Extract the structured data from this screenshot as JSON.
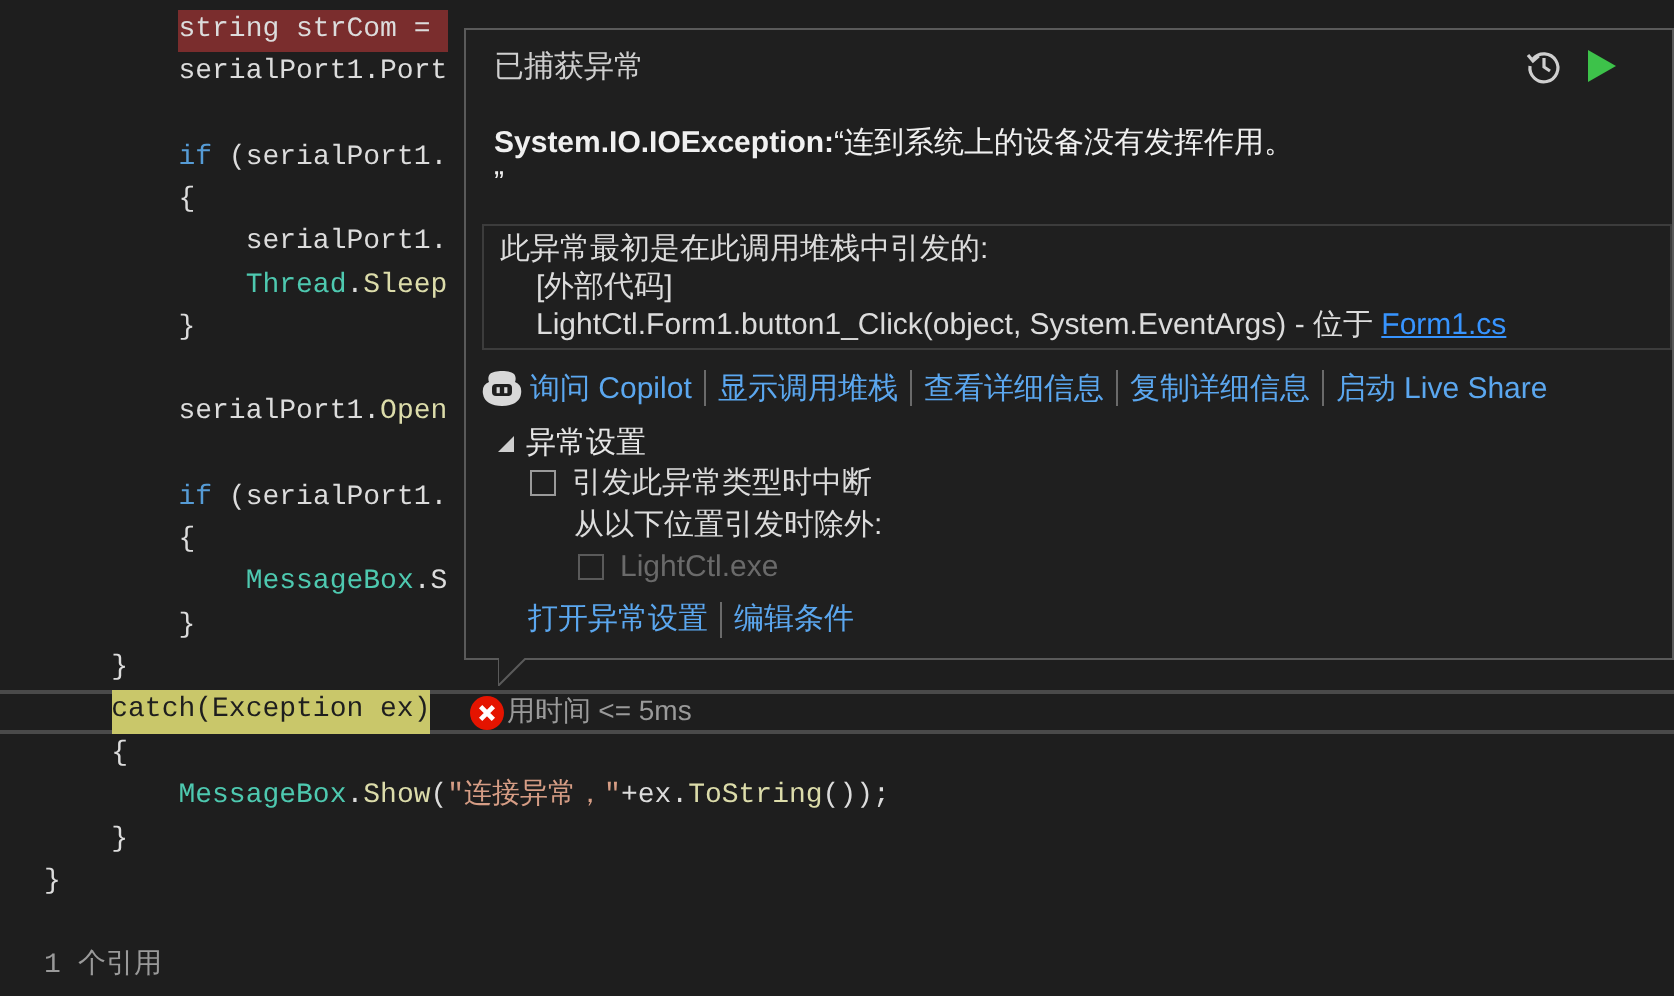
{
  "editor": {
    "lines": [
      {
        "kind": "code",
        "exception_line": true,
        "segments": [
          {
            "text": "        string strCom = ",
            "kind": "plain"
          }
        ]
      },
      {
        "kind": "code",
        "segments": [
          {
            "text": "        serialPort1.Port",
            "kind": "plain"
          }
        ]
      },
      {
        "kind": "blank"
      },
      {
        "kind": "code",
        "segments": [
          {
            "text": "        if",
            "kind": "keyword"
          },
          {
            "text": " (serialPort1.",
            "kind": "plain"
          }
        ]
      },
      {
        "kind": "code",
        "segments": [
          {
            "text": "        {",
            "kind": "plain"
          }
        ]
      },
      {
        "kind": "code",
        "segments": [
          {
            "text": "            serialPort1.",
            "kind": "plain"
          }
        ]
      },
      {
        "kind": "code",
        "segments": [
          {
            "text": "            Thread",
            "kind": "type"
          },
          {
            "text": ".",
            "kind": "plain"
          },
          {
            "text": "Sleep",
            "kind": "method"
          }
        ]
      },
      {
        "kind": "code",
        "segments": [
          {
            "text": "        }",
            "kind": "plain"
          }
        ]
      },
      {
        "kind": "blank"
      },
      {
        "kind": "code",
        "segments": [
          {
            "text": "        serialPort1.",
            "kind": "plain"
          },
          {
            "text": "Open",
            "kind": "method"
          }
        ]
      },
      {
        "kind": "blank"
      },
      {
        "kind": "code",
        "segments": [
          {
            "text": "        if",
            "kind": "keyword"
          },
          {
            "text": " (serialPort1.",
            "kind": "plain"
          }
        ]
      },
      {
        "kind": "code",
        "segments": [
          {
            "text": "        {",
            "kind": "plain"
          }
        ]
      },
      {
        "kind": "code",
        "segments": [
          {
            "text": "            MessageBox",
            "kind": "type"
          },
          {
            "text": ".S",
            "kind": "plain"
          }
        ]
      },
      {
        "kind": "code",
        "segments": [
          {
            "text": "        }",
            "kind": "plain"
          }
        ]
      },
      {
        "kind": "code",
        "segments": [
          {
            "text": "    }",
            "kind": "plain"
          }
        ]
      },
      {
        "kind": "code",
        "current_catch": true,
        "segments": [
          {
            "text": "    catch(Exception ex)",
            "kind": "plain"
          }
        ],
        "hint": {
          "text": "用时间 <= 5ms",
          "error": true
        }
      },
      {
        "kind": "code",
        "segments": [
          {
            "text": "    {",
            "kind": "plain"
          }
        ]
      },
      {
        "kind": "code",
        "segments": [
          {
            "text": "        MessageBox",
            "kind": "type"
          },
          {
            "text": ".",
            "kind": "plain"
          },
          {
            "text": "Show",
            "kind": "method"
          },
          {
            "text": "(",
            "kind": "plain"
          },
          {
            "text": "\"连接异常，\"",
            "kind": "string"
          },
          {
            "text": "+ex.",
            "kind": "plain"
          },
          {
            "text": "ToString",
            "kind": "method"
          },
          {
            "text": "());",
            "kind": "plain"
          }
        ]
      },
      {
        "kind": "code",
        "segments": [
          {
            "text": "    }",
            "kind": "plain"
          }
        ]
      },
      {
        "kind": "code",
        "segments": [
          {
            "text": "}",
            "kind": "plain"
          }
        ]
      },
      {
        "kind": "blank"
      },
      {
        "kind": "codelens",
        "text": "1 个引用"
      }
    ]
  },
  "exception_popup": {
    "title": "已捕获异常",
    "exception_type": "System.IO.IOException:",
    "message": "“连到系统上的设备没有发挥作用。",
    "message_end": "”",
    "stack": {
      "heading": "此异常最初是在此调用堆栈中引发的:",
      "frames": [
        {
          "text": "[外部代码]"
        },
        {
          "text": "LightCtl.Form1.button1_Click(object, System.EventArgs) - 位于",
          "link": "Form1.cs"
        }
      ]
    },
    "actions": [
      {
        "label": "询问 Copilot"
      },
      {
        "label": "显示调用堆栈"
      },
      {
        "label": "查看详细信息"
      },
      {
        "label": "复制详细信息"
      },
      {
        "label": "启动 Live Share"
      }
    ],
    "settings": {
      "label": "异常设置",
      "expanded": true,
      "break_option": {
        "label": "引发此异常类型时中断",
        "checked": false
      },
      "except_label": "从以下位置引发时除外:",
      "modules": [
        {
          "label": "LightCtl.exe",
          "checked": false,
          "disabled": true
        }
      ],
      "links": [
        "打开异常设置",
        "编辑条件"
      ]
    }
  }
}
